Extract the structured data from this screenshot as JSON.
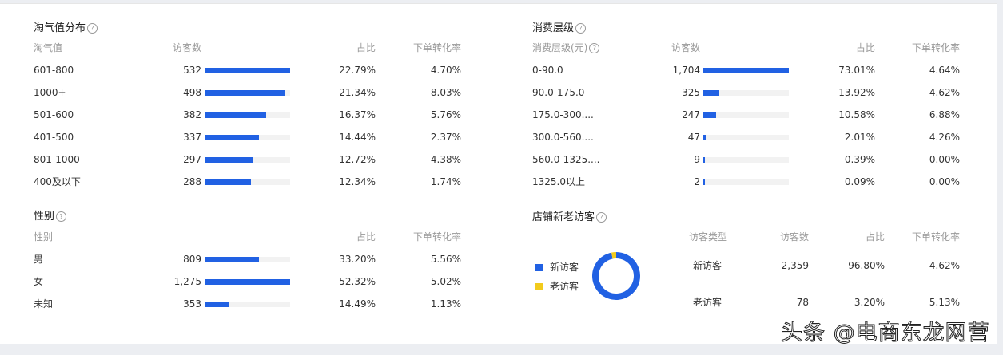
{
  "taoqi": {
    "title": "淘气值分布",
    "headers": [
      "淘气值",
      "访客数",
      "占比",
      "下单转化率"
    ],
    "rows": [
      {
        "label": "601-800",
        "count": "532",
        "value": 532,
        "pct": "22.79%",
        "conv": "4.70%"
      },
      {
        "label": "1000+",
        "count": "498",
        "value": 498,
        "pct": "21.34%",
        "conv": "8.03%"
      },
      {
        "label": "501-600",
        "count": "382",
        "value": 382,
        "pct": "16.37%",
        "conv": "5.76%"
      },
      {
        "label": "401-500",
        "count": "337",
        "value": 337,
        "pct": "14.44%",
        "conv": "2.37%"
      },
      {
        "label": "801-1000",
        "count": "297",
        "value": 297,
        "pct": "12.72%",
        "conv": "4.38%"
      },
      {
        "label": "400及以下",
        "count": "288",
        "value": 288,
        "pct": "12.34%",
        "conv": "1.74%"
      }
    ]
  },
  "spend": {
    "title": "消费层级",
    "headers": [
      "消费层级(元)",
      "访客数",
      "占比",
      "下单转化率"
    ],
    "rows": [
      {
        "label": "0-90.0",
        "count": "1,704",
        "value": 1704,
        "pct": "73.01%",
        "conv": "4.64%"
      },
      {
        "label": "90.0-175.0",
        "count": "325",
        "value": 325,
        "pct": "13.92%",
        "conv": "4.62%"
      },
      {
        "label": "175.0-300....",
        "count": "247",
        "value": 247,
        "pct": "10.58%",
        "conv": "6.88%"
      },
      {
        "label": "300.0-560....",
        "count": "47",
        "value": 47,
        "pct": "2.01%",
        "conv": "4.26%"
      },
      {
        "label": "560.0-1325....",
        "count": "9",
        "value": 9,
        "pct": "0.39%",
        "conv": "0.00%"
      },
      {
        "label": "1325.0以上",
        "count": "2",
        "value": 2,
        "pct": "0.09%",
        "conv": "0.00%"
      }
    ]
  },
  "gender": {
    "title": "性别",
    "headers": [
      "性别",
      "占比",
      "下单转化率"
    ],
    "rows": [
      {
        "label": "男",
        "count": "809",
        "value": 809,
        "pct": "33.20%",
        "conv": "5.56%"
      },
      {
        "label": "女",
        "count": "1,275",
        "value": 1275,
        "pct": "52.32%",
        "conv": "5.02%"
      },
      {
        "label": "未知",
        "count": "353",
        "value": 353,
        "pct": "14.49%",
        "conv": "1.13%"
      }
    ]
  },
  "visitors": {
    "title": "店铺新老访客",
    "headers": [
      "访客类型",
      "访客数",
      "占比",
      "下单转化率"
    ],
    "colors": [
      "#2161e3",
      "#f2cb1d"
    ],
    "rows": [
      {
        "label": "新访客",
        "count": "2,359",
        "value": 2359,
        "pct": "96.80%",
        "conv": "4.62%"
      },
      {
        "label": "老访客",
        "count": "78",
        "value": 78,
        "pct": "3.20%",
        "conv": "5.13%"
      }
    ]
  },
  "watermark": "头条 @电商东龙网营"
}
